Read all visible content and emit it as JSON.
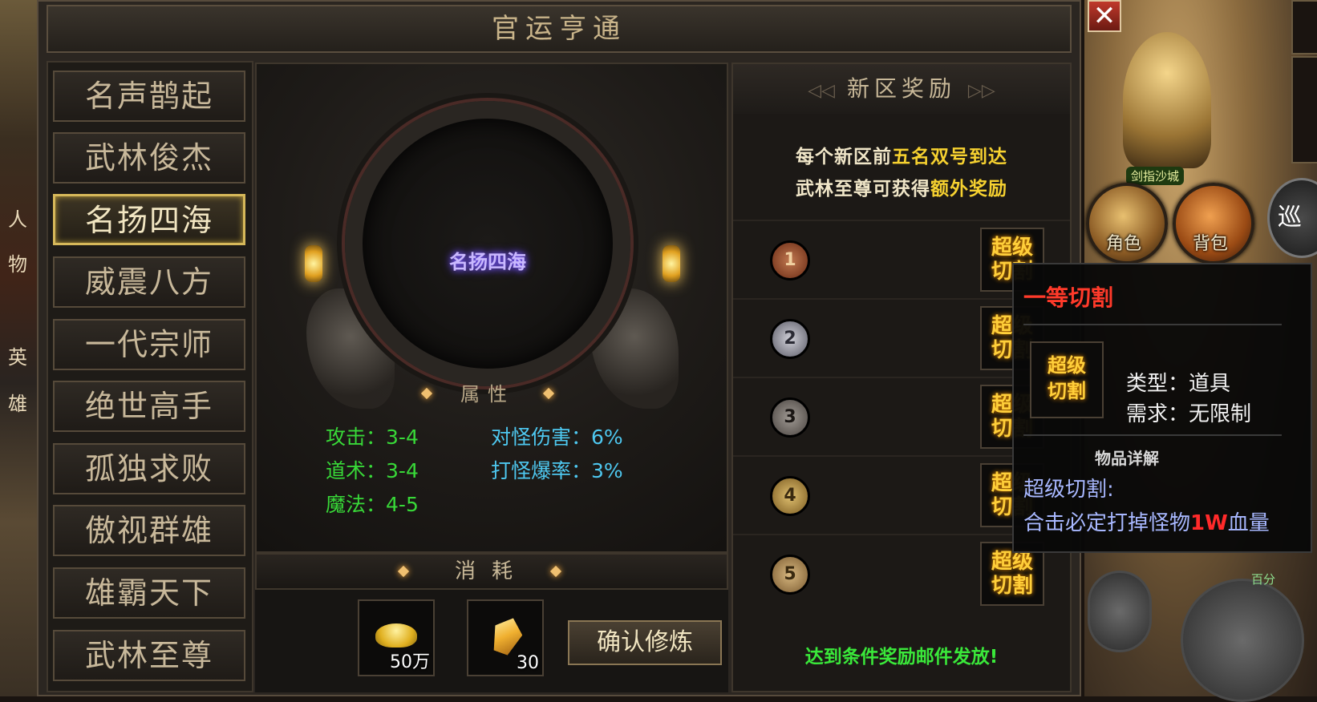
{
  "panel": {
    "title": "官运亨通",
    "close_label": "✕"
  },
  "nav": {
    "items": [
      {
        "label": "名声鹊起"
      },
      {
        "label": "武林俊杰"
      },
      {
        "label": "名扬四海",
        "active": true
      },
      {
        "label": "威震八方"
      },
      {
        "label": "一代宗师"
      },
      {
        "label": "绝世高手"
      },
      {
        "label": "孤独求败"
      },
      {
        "label": "傲视群雄"
      },
      {
        "label": "雄霸天下"
      },
      {
        "label": "武林至尊"
      }
    ]
  },
  "display": {
    "title_text": "名扬四海"
  },
  "attributes": {
    "header": "属性",
    "stats": [
      {
        "label": "攻击：",
        "value": "3-4"
      },
      {
        "label": "道术：",
        "value": "3-4"
      },
      {
        "label": "魔法：",
        "value": "4-5"
      },
      {
        "label": "对怪伤害：",
        "value": "6%"
      },
      {
        "label": "打怪爆率：",
        "value": "3%"
      }
    ]
  },
  "consume": {
    "header": "消耗",
    "items": [
      {
        "icon": "gold-ingot-icon",
        "qty": "50万"
      },
      {
        "icon": "crystal-icon",
        "qty": "30"
      }
    ],
    "confirm_label": "确认修炼"
  },
  "reward": {
    "header": "新区奖励",
    "arrow_left": "◁◁",
    "arrow_right": "▷▷",
    "desc_line1": {
      "pre": "每个新区前",
      "hl": "五名双号到达"
    },
    "desc_line2": {
      "pre": "武林至尊可获得",
      "hl": "额外奖励"
    },
    "ranks": [
      {
        "rank": "1",
        "item_label": "超级切割"
      },
      {
        "rank": "2",
        "item_label": "超级切割"
      },
      {
        "rank": "3",
        "item_label": "超级切割"
      },
      {
        "rank": "4",
        "item_label": "超级切割"
      },
      {
        "rank": "5",
        "item_label": "超级切割"
      }
    ],
    "footer": "达到条件奖励邮件发放!"
  },
  "tooltip": {
    "title": "一等切割",
    "icon_label_1": "超级",
    "icon_label_2": "切割",
    "type_label": "类型：",
    "type_value": "道具",
    "req_label": "需求：",
    "req_value": "无限制",
    "section": "物品详解",
    "desc_name": "超级切割:",
    "desc_pre": "合击必定打掉怪物",
    "desc_hl": "1W",
    "desc_post": "血量"
  },
  "world": {
    "left_tabs": [
      "人",
      "物",
      "英",
      "雄"
    ],
    "right_buttons": [
      {
        "label": "角色"
      },
      {
        "label": "背包"
      }
    ],
    "map_label": "剑指沙城",
    "patrol_label": "巡",
    "skill_label": "百分"
  },
  "colors": {
    "accent_gold": "#d6b85a",
    "highlight_yellow": "#f6d130",
    "tooltip_red": "#ff3a2a",
    "stat_green": "#38d838",
    "stat_cyan": "#4ec8f0"
  }
}
